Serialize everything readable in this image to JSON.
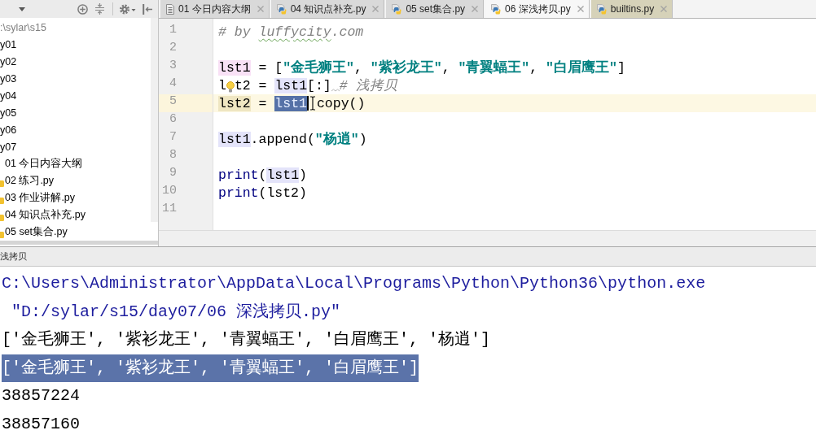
{
  "tabs": [
    {
      "label": "01 今日内容大纲",
      "kind": "text",
      "selected": false
    },
    {
      "label": "04 知识点补充.py",
      "kind": "python",
      "selected": false
    },
    {
      "label": "05 set集合.py",
      "kind": "python",
      "selected": false
    },
    {
      "label": "06 深浅拷贝.py",
      "kind": "python",
      "selected": true
    },
    {
      "label": "builtins.py",
      "kind": "library",
      "selected": false
    }
  ],
  "project_tree": {
    "items": [
      {
        "label": ":\\sylar\\s15",
        "kind": "root",
        "children": [
          {
            "label": "y01",
            "kind": "folder"
          },
          {
            "label": "y02",
            "kind": "folder"
          },
          {
            "label": "y03",
            "kind": "folder"
          },
          {
            "label": "y04",
            "kind": "folder"
          },
          {
            "label": "y05",
            "kind": "folder"
          },
          {
            "label": "y06",
            "kind": "folder"
          },
          {
            "label": "y07",
            "kind": "folder",
            "children": [
              {
                "label": "01 今日内容大纲",
                "kind": "text_file"
              },
              {
                "label": "02 练习.py",
                "kind": "python_file"
              },
              {
                "label": "03 作业讲解.py",
                "kind": "python_file"
              },
              {
                "label": "04 知识点补充.py",
                "kind": "python_file"
              },
              {
                "label": "05 set集合.py",
                "kind": "python_file"
              }
            ]
          }
        ]
      }
    ]
  },
  "editor": {
    "lines": [
      {
        "number": "1",
        "current": false,
        "tokens": [
          {
            "kind": "comment",
            "text": "# by "
          },
          {
            "kind": "misspelled",
            "text": "luffycity"
          },
          {
            "kind": "comment",
            "text": ".com"
          }
        ]
      },
      {
        "number": "2",
        "current": false
      },
      {
        "number": "3",
        "current": false,
        "tokens": [
          {
            "kind": "def",
            "text": "lst1"
          },
          {
            "kind": "plain",
            "text": " = ["
          },
          {
            "kind": "string",
            "text": "\"金毛狮王\""
          },
          {
            "kind": "plain",
            "text": ", "
          },
          {
            "kind": "string",
            "text": "\"紫衫龙王\""
          },
          {
            "kind": "plain",
            "text": ", "
          },
          {
            "kind": "string",
            "text": "\"青翼蝠王\""
          },
          {
            "kind": "plain",
            "text": ", "
          },
          {
            "kind": "string",
            "text": "\"白眉鹰王\""
          },
          {
            "kind": "plain",
            "text": "]"
          }
        ]
      },
      {
        "number": "4",
        "current": false,
        "tokens": [
          {
            "kind": "plain",
            "text": "l"
          },
          {
            "kind": "bulb"
          },
          {
            "kind": "plain",
            "text": "t2 = "
          },
          {
            "kind": "ref",
            "text": "lst1"
          },
          {
            "kind": "plain",
            "text": "[:]"
          },
          {
            "kind": "squiggle"
          },
          {
            "kind": "comment",
            "text": "# 浅拷贝"
          }
        ]
      },
      {
        "number": "5",
        "current": true,
        "tokens": [
          {
            "kind": "write",
            "text": "lst2"
          },
          {
            "kind": "plain",
            "text": " = "
          },
          {
            "kind": "selected",
            "text": "lst1"
          },
          {
            "kind": "caret"
          },
          {
            "kind": "pointer"
          },
          {
            "kind": "plain",
            "text": "copy()"
          }
        ]
      },
      {
        "number": "6",
        "current": false
      },
      {
        "number": "7",
        "current": false,
        "tokens": [
          {
            "kind": "ref",
            "text": "lst1"
          },
          {
            "kind": "plain",
            "text": ".append("
          },
          {
            "kind": "string",
            "text": "\"杨逍\""
          },
          {
            "kind": "plain",
            "text": ")"
          }
        ]
      },
      {
        "number": "8",
        "current": false
      },
      {
        "number": "9",
        "current": false,
        "tokens": [
          {
            "kind": "builtin",
            "text": "print"
          },
          {
            "kind": "plain",
            "text": "("
          },
          {
            "kind": "ref",
            "text": "lst1"
          },
          {
            "kind": "plain",
            "text": ")"
          }
        ]
      },
      {
        "number": "10",
        "current": false,
        "tokens": [
          {
            "kind": "builtin",
            "text": "print"
          },
          {
            "kind": "plain",
            "text": "(lst2)"
          }
        ]
      },
      {
        "number": "11",
        "current": false
      }
    ]
  },
  "run_panel": {
    "title": "浅拷贝",
    "lines": [
      {
        "kind": "command",
        "text": "C:\\Users\\Administrator\\AppData\\Local\\Programs\\Python\\Python36\\python.exe",
        "selected": false
      },
      {
        "kind": "command",
        "text": " \"D:/sylar/s15/day07/06 深浅拷贝.py\"",
        "selected": false
      },
      {
        "kind": "output",
        "text": "['金毛狮王', '紫衫龙王', '青翼蝠王', '白眉鹰王', '杨逍']",
        "selected": false
      },
      {
        "kind": "output",
        "text": "['金毛狮王', '紫衫龙王', '青翼蝠王', '白眉鹰王']",
        "selected": true
      },
      {
        "kind": "output",
        "text": "38857224",
        "selected": false
      },
      {
        "kind": "output",
        "text": "38857160",
        "selected": false
      }
    ]
  }
}
